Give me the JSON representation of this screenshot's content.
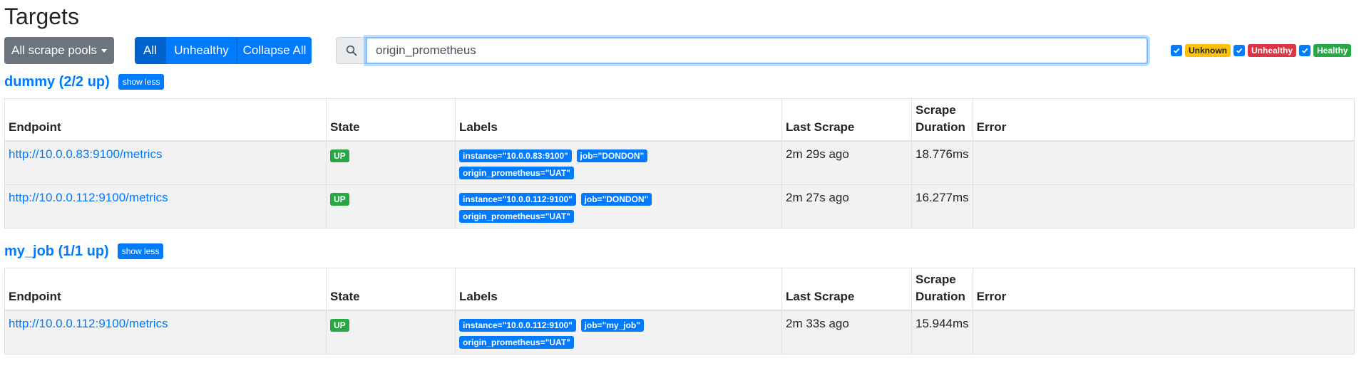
{
  "page": {
    "title": "Targets"
  },
  "toolbar": {
    "pools_label": "All scrape pools",
    "filter_buttons": [
      "All",
      "Unhealthy",
      "Collapse All"
    ],
    "search_value": "origin_prometheus",
    "status_filters": [
      "Unknown",
      "Unhealthy",
      "Healthy"
    ]
  },
  "colors": {
    "primary": "#007bff",
    "secondary": "#6c757d",
    "up": "#28a745",
    "unknown": "#ffc107",
    "unhealthy": "#dc3545"
  },
  "columns": [
    "Endpoint",
    "State",
    "Labels",
    "Last Scrape",
    "Scrape Duration",
    "Error"
  ],
  "pools": [
    {
      "name": "dummy (2/2 up)",
      "toggle": "show less",
      "rows": [
        {
          "endpoint": "http://10.0.0.83:9100/metrics",
          "state": "UP",
          "labels": [
            "instance=\"10.0.0.83:9100\"",
            "job=\"DONDON\"",
            "origin_prometheus=\"UAT\""
          ],
          "last_scrape": "2m 29s ago",
          "duration": "18.776ms",
          "error": ""
        },
        {
          "endpoint": "http://10.0.0.112:9100/metrics",
          "state": "UP",
          "labels": [
            "instance=\"10.0.0.112:9100\"",
            "job=\"DONDON\"",
            "origin_prometheus=\"UAT\""
          ],
          "last_scrape": "2m 27s ago",
          "duration": "16.277ms",
          "error": ""
        }
      ]
    },
    {
      "name": "my_job (1/1 up)",
      "toggle": "show less",
      "rows": [
        {
          "endpoint": "http://10.0.0.112:9100/metrics",
          "state": "UP",
          "labels": [
            "instance=\"10.0.0.112:9100\"",
            "job=\"my_job\"",
            "origin_prometheus=\"UAT\""
          ],
          "last_scrape": "2m 33s ago",
          "duration": "15.944ms",
          "error": ""
        }
      ]
    }
  ]
}
